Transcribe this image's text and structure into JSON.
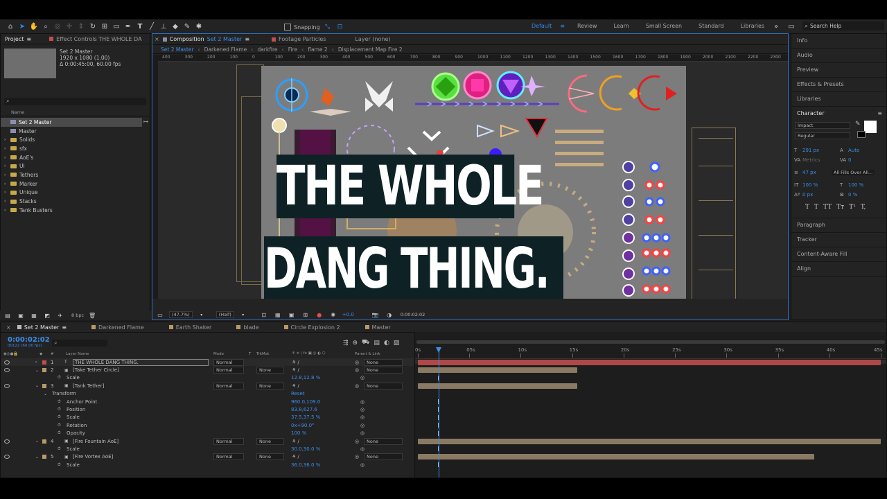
{
  "toolbar": {
    "snapping_label": "Snapping",
    "workspaces": [
      {
        "label": "Default",
        "active": true
      },
      {
        "label": "Review",
        "active": false
      },
      {
        "label": "Learn",
        "active": false
      },
      {
        "label": "Small Screen",
        "active": false
      },
      {
        "label": "Standard",
        "active": false
      },
      {
        "label": "Libraries",
        "active": false
      }
    ],
    "search_placeholder": "Search Help"
  },
  "project_panel": {
    "tab_project": "Project",
    "tab_effect_controls": "Effect Controls THE WHOLE DA",
    "selected_name": "Set 2 Master",
    "selected_dims": "1920 x 1080 (1.00)",
    "selected_duration": "Δ 0:00:45:00, 60.00 fps",
    "search_placeholder": "",
    "column_name": "Name",
    "bpc": "8 bpc",
    "items": [
      {
        "name": "Set 2 Master",
        "type": "comp",
        "selected": true
      },
      {
        "name": "Master",
        "type": "comp",
        "selected": false
      },
      {
        "name": "Solids",
        "type": "folder",
        "selected": false
      },
      {
        "name": "sfx",
        "type": "folder",
        "selected": false
      },
      {
        "name": "AoE's",
        "type": "folder",
        "selected": false
      },
      {
        "name": "UI",
        "type": "folder",
        "selected": false
      },
      {
        "name": "Tethers",
        "type": "folder",
        "selected": false
      },
      {
        "name": "Marker",
        "type": "folder",
        "selected": false
      },
      {
        "name": "Unique",
        "type": "folder",
        "selected": false
      },
      {
        "name": "Stacks",
        "type": "folder",
        "selected": false
      },
      {
        "name": "Tank Busters",
        "type": "folder",
        "selected": false
      }
    ]
  },
  "comp_panel": {
    "tab_composition": "Composition",
    "tab_composition_name": "Set 2 Master",
    "tab_footage": "Footage Particles",
    "tab_layer": "Layer (none)",
    "breadcrumbs": [
      "Set 2 Master",
      "Darkened Flame",
      "darkfire",
      "Fire",
      "flame 2",
      "Displacement Map Fire 2"
    ],
    "ruler_labels": [
      "400",
      "300",
      "200",
      "100",
      "0",
      "100",
      "200",
      "300",
      "400",
      "500",
      "600",
      "700",
      "800",
      "900",
      "1000",
      "1100",
      "1200",
      "1300",
      "1400",
      "1500",
      "1600",
      "1700",
      "1800",
      "1900",
      "2000",
      "2100",
      "2200",
      "2300"
    ],
    "overlay_line1": "THE WHOLE",
    "overlay_line2": "DANG THING.",
    "zoom": "(47.7%)",
    "resolution": "(Half)",
    "exposure": "+0.0",
    "timecode": "0:00:02:02"
  },
  "right_panel": {
    "top_items": [
      "Info",
      "Audio",
      "Preview",
      "Effects & Presets",
      "Libraries"
    ],
    "character": {
      "title": "Character",
      "font": "Impact",
      "style": "Regular",
      "size": "291 px",
      "leading": "Auto",
      "kerning": "Metrics",
      "tracking": "0",
      "stroke_width": "47 px",
      "stroke_mode": "All Fills Over All...",
      "vscale": "100 %",
      "hscale": "100 %",
      "baseline": "0 px",
      "tsume": "0 %",
      "styles": [
        "T",
        "T",
        "TT",
        "Tт",
        "T¹",
        "T,"
      ]
    },
    "bottom_items": [
      "Paragraph",
      "Tracker",
      "Content-Aware Fill",
      "Align"
    ]
  },
  "timeline": {
    "tabs": [
      {
        "label": "Set 2 Master",
        "color": "#b9b9b9",
        "active": true
      },
      {
        "label": "Darkened Flame",
        "color": "#b79a66",
        "active": false
      },
      {
        "label": "Earth Shaker",
        "color": "#b79a66",
        "active": false
      },
      {
        "label": "blade",
        "color": "#b79a66",
        "active": false
      },
      {
        "label": "Circle Explosion 2",
        "color": "#b79a66",
        "active": false
      },
      {
        "label": "Master",
        "color": "#b79a66",
        "active": false
      }
    ],
    "timecode": "0:00:02:02",
    "timecode_sub": "00122 (60.00 fps)",
    "headers": {
      "layer_name": "Layer Name",
      "mode": "Mode",
      "t": "T",
      "trkmat": "TrkMat",
      "parent": "Parent & Link"
    },
    "ruler": [
      "0s",
      "05s",
      "10s",
      "15s",
      "20s",
      "25s",
      "30s",
      "35s",
      "40s",
      "45s"
    ],
    "duration_seconds": 45,
    "current_time_seconds": 2.03,
    "reset_label": "Reset",
    "rows": [
      {
        "kind": "layer",
        "num": "1",
        "name": "THE WHOLE DANG THING.",
        "type": "text",
        "label_color": "#c44d4d",
        "mode": "Normal",
        "trkmat": "",
        "parent": "None",
        "bar_start": 0,
        "bar_end": 45,
        "bar_color": "#b04848"
      },
      {
        "kind": "layer",
        "num": "2",
        "name": "[Take Tether Circle]",
        "type": "comp",
        "label_color": "#b79a66",
        "mode": "Normal",
        "trkmat": "None",
        "parent": "None",
        "bar_start": 0,
        "bar_end": 15.5,
        "bar_color": "#8a7a63"
      },
      {
        "kind": "prop",
        "name": "Scale",
        "value": "12.8,12.8 %",
        "indent": 1
      },
      {
        "kind": "layer",
        "num": "3",
        "name": "[Tank Tether]",
        "type": "comp",
        "label_color": "#b79a66",
        "mode": "Normal",
        "trkmat": "None",
        "parent": "None",
        "bar_start": 0,
        "bar_end": 15.5,
        "bar_color": "#8a7a63"
      },
      {
        "kind": "group",
        "name": "Transform",
        "value": "Reset"
      },
      {
        "kind": "prop",
        "name": "Anchor Point",
        "value": "960.0,109.0",
        "indent": 1
      },
      {
        "kind": "prop",
        "name": "Position",
        "value": "83.8,627.6",
        "indent": 1
      },
      {
        "kind": "prop",
        "name": "Scale",
        "value": "37.5,37.5 %",
        "indent": 1
      },
      {
        "kind": "prop",
        "name": "Rotation",
        "value": "0x+90.0°",
        "indent": 1
      },
      {
        "kind": "prop",
        "name": "Opacity",
        "value": "100 %",
        "indent": 1
      },
      {
        "kind": "layer",
        "num": "4",
        "name": "[Fire Fountain AoE]",
        "type": "comp",
        "label_color": "#b79a66",
        "mode": "Normal",
        "trkmat": "None",
        "parent": "None",
        "bar_start": 0,
        "bar_end": 45,
        "bar_color": "#8a7a63"
      },
      {
        "kind": "prop",
        "name": "Scale",
        "value": "30.0,30.0 %",
        "indent": 1
      },
      {
        "kind": "layer",
        "num": "5",
        "name": "[Fire Vortex AoE]",
        "type": "comp",
        "label_color": "#b79a66",
        "mode": "Normal",
        "trkmat": "None",
        "parent": "None",
        "bar_start": 0,
        "bar_end": 38.5,
        "bar_color": "#8a7a63"
      },
      {
        "kind": "prop",
        "name": "Scale",
        "value": "36.0,36.0 %",
        "indent": 1
      }
    ]
  }
}
